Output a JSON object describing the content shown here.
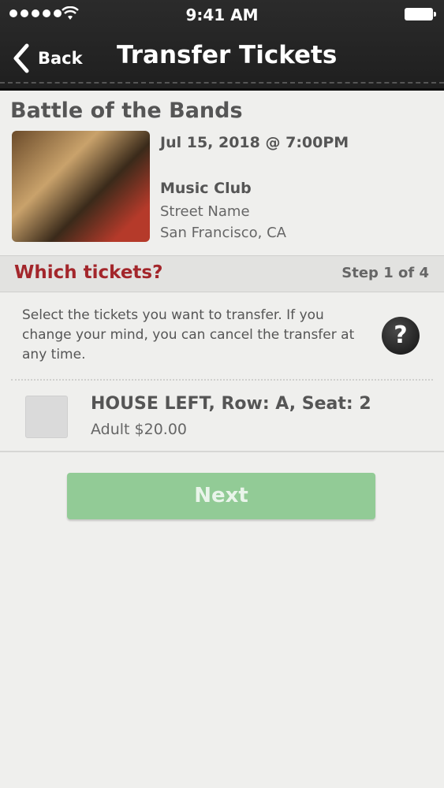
{
  "status_bar": {
    "time": "9:41 AM"
  },
  "header": {
    "back_label": "Back",
    "title": "Transfer Tickets"
  },
  "event": {
    "title": "Battle of the Bands",
    "date": "Jul 15, 2018 @ 7:00PM",
    "venue_name": "Music Club",
    "street": "Street Name",
    "city": "San Francisco, CA"
  },
  "section": {
    "title": "Which tickets?",
    "step": "Step 1 of 4"
  },
  "instructions": "Select the tickets you want to transfer. If you change your mind, you can cancel the transfer at any time.",
  "help_label": "?",
  "ticket": {
    "name": "HOUSE LEFT, Row: A, Seat: 2",
    "price": "Adult $20.00",
    "checked": false
  },
  "next_label": "Next"
}
